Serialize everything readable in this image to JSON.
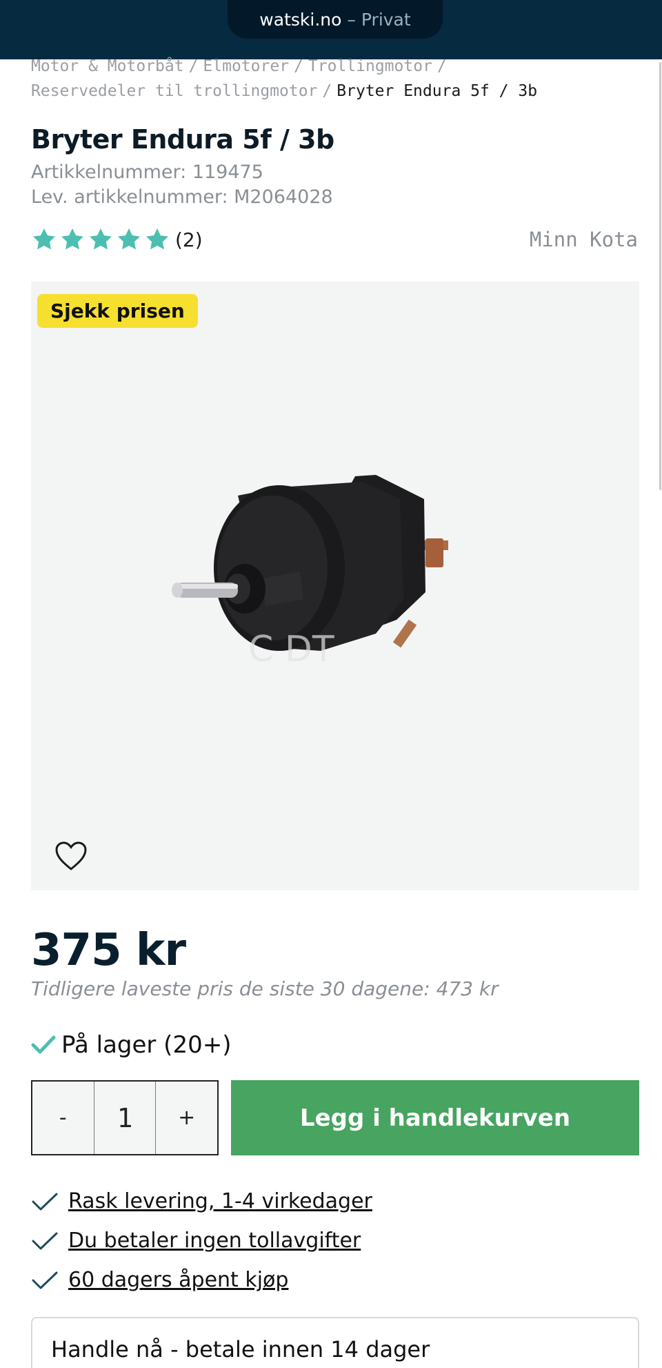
{
  "browser": {
    "host": "watski.no",
    "separator": "–",
    "mode": "Privat"
  },
  "breadcrumb": {
    "items": [
      "Motor & Motorbåt",
      "Elmotorer",
      "Trollingmotor",
      "Reservedeler til trollingmotor"
    ],
    "separator": "/",
    "current": "Bryter Endura 5f / 3b"
  },
  "product": {
    "title": "Bryter Endura 5f / 3b",
    "article_number": "Artikkelnummer: 119475",
    "supplier_number": "Lev. artikkelnummer: M2064028",
    "rating": {
      "stars": 5,
      "max": 5,
      "count_label": "(2)"
    },
    "brand": "Minn Kota",
    "badge": "Sjekk prisen",
    "image_icon": "product-switch-photo",
    "favorite_icon": "heart-outline-icon"
  },
  "pricing": {
    "price": "375 kr",
    "previous_lowest": "Tidligere laveste pris de siste 30 dagene: 473 kr"
  },
  "stock": {
    "label": "På lager (20+)"
  },
  "cart": {
    "decrement_label": "-",
    "quantity": "1",
    "increment_label": "+",
    "add_label": "Legg i handlekurven"
  },
  "benefits": [
    "Rask levering, 1-4 virkedager",
    "Du betaler ingen tollavgifter",
    "60 dagers åpent kjøp"
  ],
  "payment": {
    "label": "Handle nå - betale innen 14 dager"
  },
  "colors": {
    "topbar": "#062a40",
    "star": "#4dbfb0",
    "badge": "#f6df2f",
    "add_button": "#47a461",
    "check": "#4dbfb0"
  }
}
